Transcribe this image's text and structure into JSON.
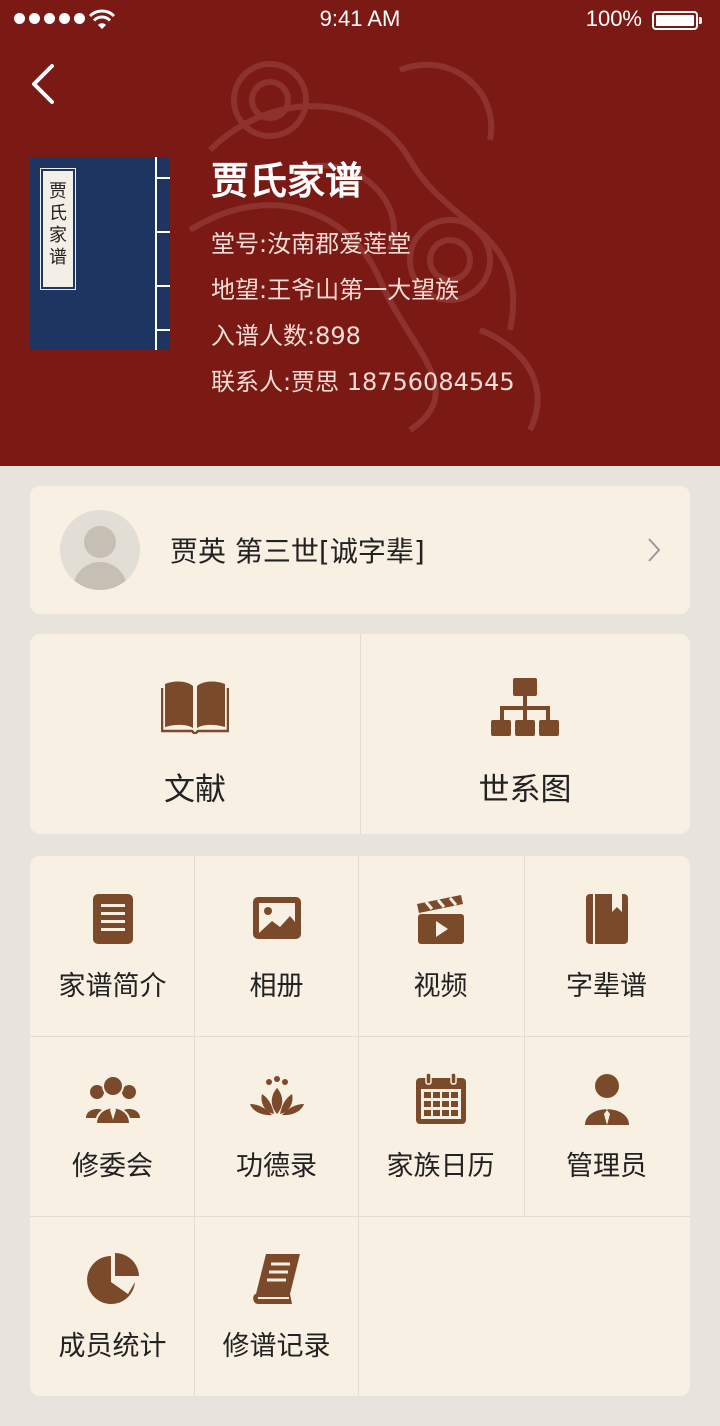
{
  "status_bar": {
    "time": "9:41 AM",
    "battery": "100%"
  },
  "header": {
    "book_label": [
      "贾",
      "氏",
      "家",
      "谱"
    ],
    "title": "贾氏家谱",
    "lines": [
      "堂号:汝南郡爱莲堂",
      "地望:王爷山第一大望族",
      "入谱人数:898",
      "联系人:贾思 18756084545"
    ]
  },
  "profile": {
    "name": "贾英  第三世[诚字辈]"
  },
  "main_actions": [
    {
      "label": "文献",
      "icon": "open-book-icon"
    },
    {
      "label": "世系图",
      "icon": "org-chart-icon"
    }
  ],
  "grid": [
    {
      "label": "家谱简介",
      "icon": "document-icon"
    },
    {
      "label": "相册",
      "icon": "picture-icon"
    },
    {
      "label": "视频",
      "icon": "clapperboard-icon"
    },
    {
      "label": "字辈谱",
      "icon": "bookmark-book-icon"
    },
    {
      "label": "修委会",
      "icon": "group-icon"
    },
    {
      "label": "功德录",
      "icon": "lotus-icon"
    },
    {
      "label": "家族日历",
      "icon": "calendar-icon"
    },
    {
      "label": "管理员",
      "icon": "admin-icon"
    },
    {
      "label": "成员统计",
      "icon": "pie-chart-icon"
    },
    {
      "label": "修谱记录",
      "icon": "book-record-icon"
    }
  ],
  "colors": {
    "header_bg": "#7b1915",
    "icon": "#7b4a2a",
    "card_bg": "#f8f0e3",
    "page_bg": "#e9e3dd",
    "book_cover": "#1d3560"
  }
}
